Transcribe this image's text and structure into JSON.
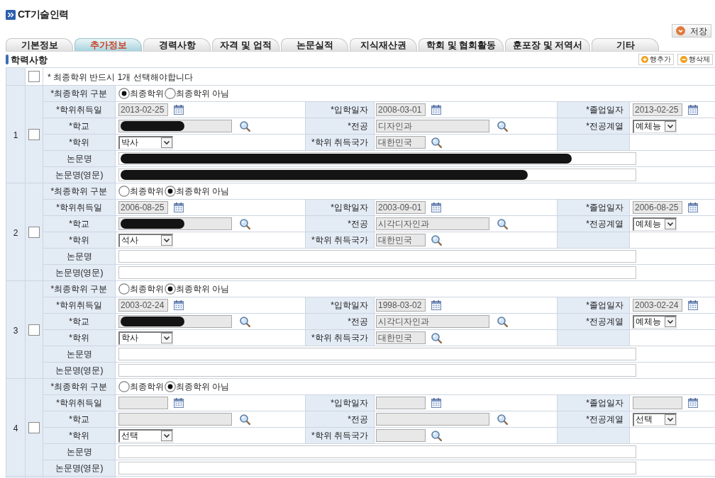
{
  "page": {
    "title": "CT기술인력"
  },
  "save_button": {
    "label": "저장"
  },
  "tabs": [
    {
      "label": "기본정보",
      "selected": false
    },
    {
      "label": "추가정보",
      "selected": true
    },
    {
      "label": "경력사항",
      "selected": false
    },
    {
      "label": "자격 및 업적",
      "selected": false
    },
    {
      "label": "논문실적",
      "selected": false
    },
    {
      "label": "지식재산권",
      "selected": false
    },
    {
      "label": "학회 및 협회활동",
      "selected": false
    },
    {
      "label": "훈포장 및 저역서",
      "selected": false
    },
    {
      "label": "기타",
      "selected": false
    }
  ],
  "section": {
    "title": "학력사항",
    "buttons": [
      {
        "label": "행추가",
        "kind": "add"
      },
      {
        "label": "행삭제",
        "kind": "remove"
      }
    ]
  },
  "table": {
    "header": {
      "checked": false,
      "notice": "* 최종학위 반드시 1개 선택해야합니다"
    },
    "records": [
      {
        "number": "1",
        "checked": false,
        "degree_type": {
          "label": "*최종학위 구분",
          "options": [
            {
              "label": "최종학위",
              "selected": true
            },
            {
              "label": "최종학위 아님",
              "selected": false
            }
          ]
        },
        "degree_date": {
          "label": "*학위취득일",
          "value": "2013-02-25"
        },
        "admission_date": {
          "label": "*입학일자",
          "value": "2008-03-01"
        },
        "graduation_date": {
          "label": "*졸업일자",
          "value": "2013-02-25"
        },
        "school": {
          "label": "*학교",
          "redacted": true
        },
        "major": {
          "label": "*전공",
          "value": "디자인과"
        },
        "major_field": {
          "label": "*전공계열",
          "value": "예체능"
        },
        "degree": {
          "label": "*학위",
          "value": "박사"
        },
        "country": {
          "label": "*학위 취득국가",
          "value": "대한민국"
        },
        "thesis": {
          "label": "논문명",
          "redacted": true
        },
        "thesis_en": {
          "label": "논문명(영문)",
          "redacted": true
        }
      },
      {
        "number": "2",
        "checked": false,
        "degree_type": {
          "label": "*최종학위 구분",
          "options": [
            {
              "label": "최종학위",
              "selected": false
            },
            {
              "label": "최종학위 아님",
              "selected": true
            }
          ]
        },
        "degree_date": {
          "label": "*학위취득일",
          "value": "2006-08-25"
        },
        "admission_date": {
          "label": "*입학일자",
          "value": "2003-09-01"
        },
        "graduation_date": {
          "label": "*졸업일자",
          "value": "2006-08-25"
        },
        "school": {
          "label": "*학교",
          "redacted": true
        },
        "major": {
          "label": "*전공",
          "value": "시각디자인과"
        },
        "major_field": {
          "label": "*전공계열",
          "value": "예체능"
        },
        "degree": {
          "label": "*학위",
          "value": "석사"
        },
        "country": {
          "label": "*학위 취득국가",
          "value": "대한민국"
        },
        "thesis": {
          "label": "논문명"
        },
        "thesis_en": {
          "label": "논문명(영문)"
        }
      },
      {
        "number": "3",
        "checked": false,
        "degree_type": {
          "label": "*최종학위 구분",
          "options": [
            {
              "label": "최종학위",
              "selected": false
            },
            {
              "label": "최종학위 아님",
              "selected": true
            }
          ]
        },
        "degree_date": {
          "label": "*학위취득일",
          "value": "2003-02-24"
        },
        "admission_date": {
          "label": "*입학일자",
          "value": "1998-03-02"
        },
        "graduation_date": {
          "label": "*졸업일자",
          "value": "2003-02-24"
        },
        "school": {
          "label": "*학교",
          "redacted": true
        },
        "major": {
          "label": "*전공",
          "value": "시각디자인과"
        },
        "major_field": {
          "label": "*전공계열",
          "value": "예체능"
        },
        "degree": {
          "label": "*학위",
          "value": "학사"
        },
        "country": {
          "label": "*학위 취득국가",
          "value": "대한민국"
        },
        "thesis": {
          "label": "논문명"
        },
        "thesis_en": {
          "label": "논문명(영문)"
        }
      },
      {
        "number": "4",
        "checked": false,
        "degree_type": {
          "label": "*최종학위 구분",
          "options": [
            {
              "label": "최종학위",
              "selected": false
            },
            {
              "label": "최종학위 아님",
              "selected": true
            }
          ]
        },
        "degree_date": {
          "label": "*학위취득일"
        },
        "admission_date": {
          "label": "*입학일자"
        },
        "graduation_date": {
          "label": "*졸업일자"
        },
        "school": {
          "label": "*학교"
        },
        "major": {
          "label": "*전공"
        },
        "major_field": {
          "label": "*전공계열",
          "value": "선택"
        },
        "degree": {
          "label": "*학위",
          "value": "선택"
        },
        "country": {
          "label": "*학위 취득국가"
        },
        "thesis": {
          "label": "논문명"
        },
        "thesis_en": {
          "label": "논문명(영문)"
        }
      }
    ]
  }
}
